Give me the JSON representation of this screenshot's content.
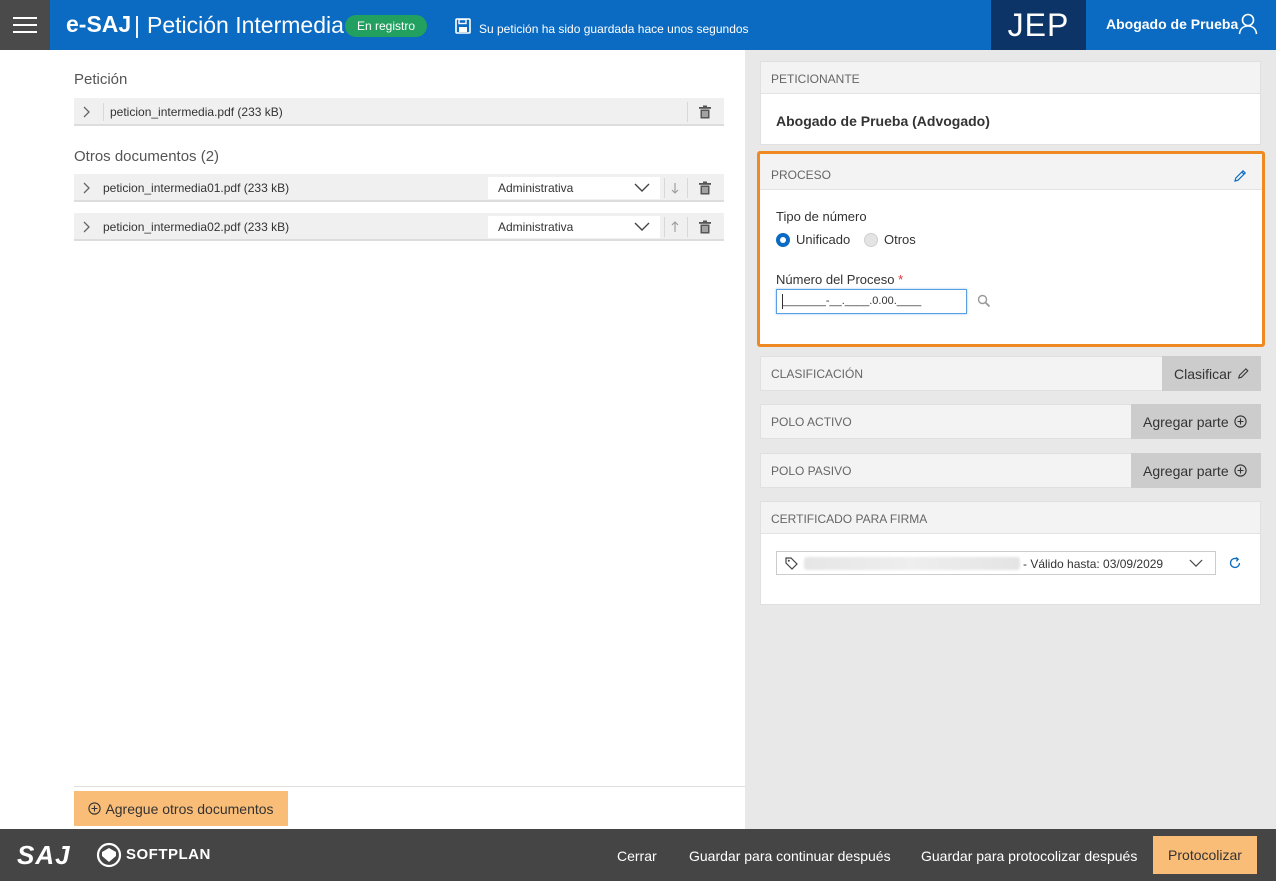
{
  "header": {
    "brand": "e-SAJ",
    "separator": "|",
    "title": "Petición Intermedia",
    "status_badge": "En registro",
    "save_message": "Su petición ha sido guardada hace unos segundos",
    "jep_label": "JEP",
    "user_name": "Abogado de Prueba"
  },
  "petition": {
    "section_title": "Petición",
    "file": "peticion_intermedia.pdf (233 kB)"
  },
  "other_docs": {
    "section_title": "Otros documentos (2)",
    "items": [
      {
        "file": "peticion_intermedia01.pdf (233 kB)",
        "type": "Administrativa"
      },
      {
        "file": "peticion_intermedia02.pdf (233 kB)",
        "type": "Administrativa"
      }
    ]
  },
  "add_documents_label": "Agregue otros documentos",
  "petitioner": {
    "header": "PETICIONANTE",
    "name": "Abogado de Prueba (Advogado)"
  },
  "process": {
    "header": "PROCESO",
    "number_type_label": "Tipo de número",
    "option_unified": "Unificado",
    "option_other": "Otros",
    "selected": "Unificado",
    "number_label": "Número del Proceso",
    "required_mark": "*",
    "number_mask": "_______-__.____.0.00.____"
  },
  "classification": {
    "header": "CLASIFICACIÓN",
    "action": "Clasificar"
  },
  "active_pole": {
    "header": "POLO ACTIVO",
    "action": "Agregar parte"
  },
  "passive_pole": {
    "header": "POLO PASIVO",
    "action": "Agregar parte"
  },
  "certificate": {
    "header": "CERTIFICADO PARA FIRMA",
    "valid_until": "- Válido hasta: 03/09/2029"
  },
  "footer": {
    "logo_saj": "SAJ",
    "logo_softplan": "SOFTPLAN",
    "close": "Cerrar",
    "save_continue": "Guardar para continuar después",
    "save_protocol": "Guardar para protocolizar después",
    "protocolize": "Protocolizar"
  },
  "colors": {
    "header_bg": "#0b6bc2",
    "jep_bg": "#0d3466",
    "badge_green": "#22a060",
    "accent_orange": "#ef8a22",
    "button_orange": "#f9bd78",
    "footer_bg": "#454545"
  }
}
